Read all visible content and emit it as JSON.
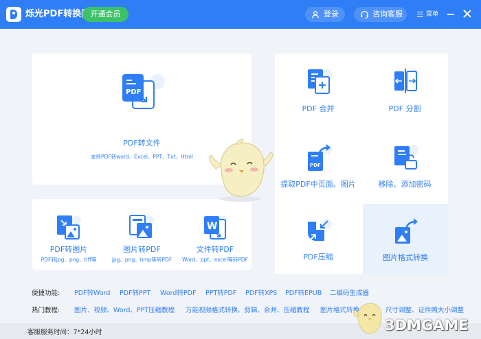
{
  "app": {
    "title": "烁光PDF转换器",
    "vip_label": "开通会员",
    "login_label": "登录",
    "service_label": "咨询客服",
    "menu_label": "菜单"
  },
  "cards": {
    "pdf_to_file": {
      "title": "PDF转文件",
      "subtitle": "支持PDF转word、Excel、PPT、Txt、Html",
      "icon_text": "PDF"
    },
    "pdf_to_image": {
      "title": "PDF转图片",
      "subtitle": "PDF转jpg、png、tiff等"
    },
    "image_to_pdf": {
      "title": "图片转PDF",
      "subtitle": "jpg、png、bmp等转PDF"
    },
    "file_to_pdf": {
      "title": "文件转PDF",
      "subtitle": "Word、ppt、excel等转PDF",
      "icon_text": "W"
    }
  },
  "tools": [
    {
      "label": "PDF 合并"
    },
    {
      "label": "PDF 分割"
    },
    {
      "label": "提取PDF中页面、图片",
      "icon_text": "PDF"
    },
    {
      "label": "移除、添加密码"
    },
    {
      "label": "PDF压缩"
    },
    {
      "label": "图片格式转换"
    }
  ],
  "quick": {
    "label": "便捷功能:",
    "links": [
      "PDF转Word",
      "PDF转PPT",
      "Word转PDF",
      "PPT转PDF",
      "PDF转XPS",
      "PDF转EPUB",
      "二维码生成器"
    ]
  },
  "hot": {
    "label": "热门教程:",
    "links": [
      "图片、视频、Word、PPT压缩教程",
      "万能视频格式转换、剪辑、合并、压缩教程",
      "图片格式转换、裁剪、尺寸调整、证件照大小调整"
    ]
  },
  "footer": {
    "service_time": "客服服务时间：7*24小时"
  },
  "watermark": "3DMGAME",
  "colors": {
    "brand": "#2f7ef5",
    "vip": "#3cc168",
    "highlight": "#e8f2fd"
  }
}
